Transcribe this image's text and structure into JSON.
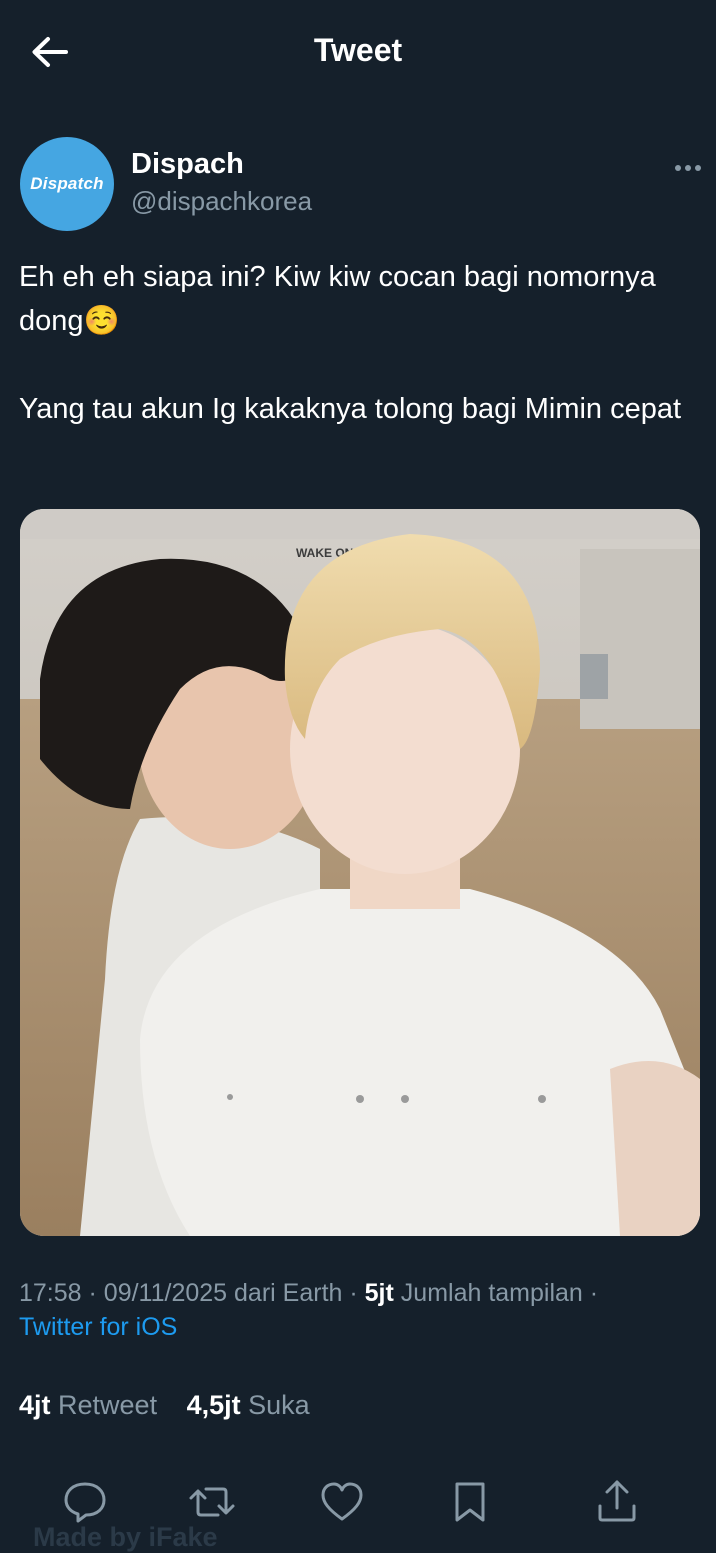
{
  "header": {
    "title": "Tweet",
    "back_icon": "arrow-left-icon"
  },
  "author": {
    "avatar_text": "Dispatch",
    "avatar_color": "#45a6e2",
    "name": "Dispach",
    "handle": "@dispachkorea"
  },
  "tweet": {
    "line1": "Eh eh eh siapa ini? Kiw kiw cocan bagi nomornya dong☺️",
    "line2": "Yang tau akun Ig kakaknya tolong bagi Mimin cepat"
  },
  "photo": {
    "wall_sign": "WAKE ONE"
  },
  "meta": {
    "time": "17:58",
    "date": "09/11/2025",
    "from": "dari Earth",
    "views_count": "5jt",
    "views_label": "Jumlah tampilan",
    "client": "Twitter for iOS",
    "sep": "·"
  },
  "stats": {
    "retweets_count": "4jt",
    "retweets_label": "Retweet",
    "likes_count": "4,5jt",
    "likes_label": "Suka"
  },
  "actions": [
    "reply-icon",
    "retweet-icon",
    "like-icon",
    "bookmark-icon",
    "share-icon"
  ],
  "watermark": "Made by iFake",
  "colors": {
    "background": "#15202b",
    "accent": "#1d9bf0",
    "muted": "#8899a6"
  }
}
